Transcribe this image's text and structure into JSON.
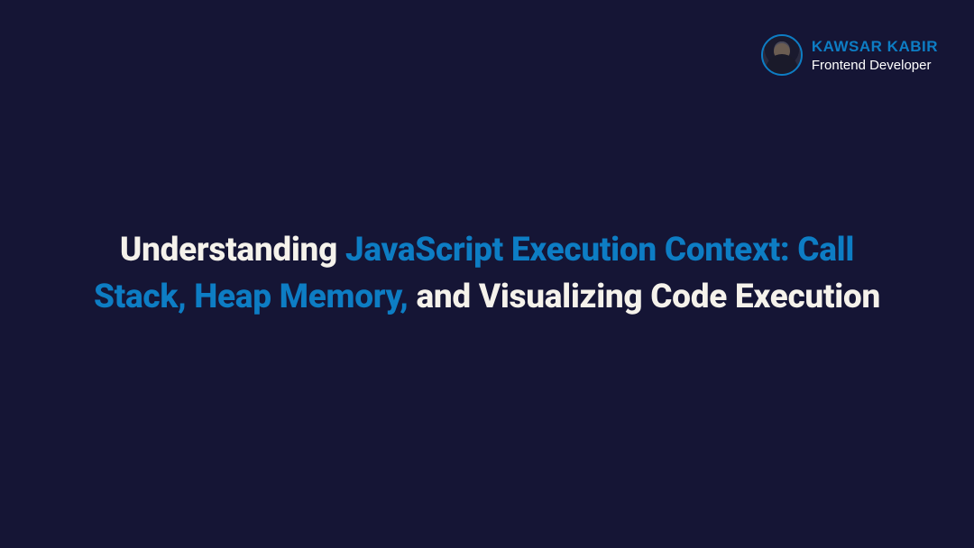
{
  "author": {
    "name": "KAWSAR KABIR",
    "role": "Frontend Developer"
  },
  "title": {
    "part1": "Understanding ",
    "part2": "JavaScript Execution Context: Call Stack, Heap Memory,",
    "part3": " and Visualizing Code Execution"
  }
}
